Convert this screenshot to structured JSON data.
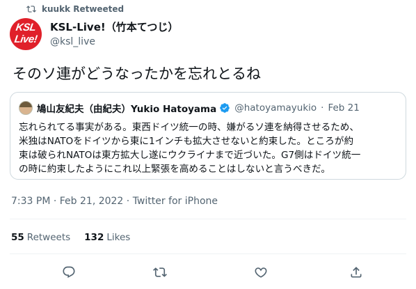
{
  "retweet_banner": {
    "text": "kuukk Retweeted",
    "icon": "retweet-icon"
  },
  "author": {
    "avatar_lines": [
      "KSL",
      "Live!"
    ],
    "name": "KSL-Live!（竹本てつじ）",
    "handle": "@ksl_live"
  },
  "tweet": {
    "text": "そのソ連がどうなったかを忘れとるね",
    "timestamp": "7:33 PM · Feb 21, 2022 · Twitter for iPhone"
  },
  "quoted_tweet": {
    "name": "鳩山友紀夫（由紀夫）Yukio Hatoyama",
    "handle": "@hatoyamayukio",
    "separator": "·",
    "date": "Feb 21",
    "lines": [
      "忘れられてる事実がある。東西ドイツ統一の時、嫌がるソ連を納得させるため、",
      "米独はNATOをドイツから東に1インチも拡大させないと約束した。ところが約",
      "束は破られNATOは東方拡大し遂にウクライナまで近づいた。G7側はドイツ統一",
      "の時に約束したようにこれ以上緊張を高めることはしないと言うべきだ。"
    ]
  },
  "stats": {
    "retweets_count": "55",
    "retweets_label": "Retweets",
    "likes_count": "132",
    "likes_label": "Likes"
  },
  "actions": [
    "reply-icon",
    "retweet-icon",
    "like-icon",
    "share-icon"
  ],
  "colors": {
    "secondary_text": "#536471",
    "verified": "#1d9bf0",
    "avatar_bg": "#e0202a"
  }
}
